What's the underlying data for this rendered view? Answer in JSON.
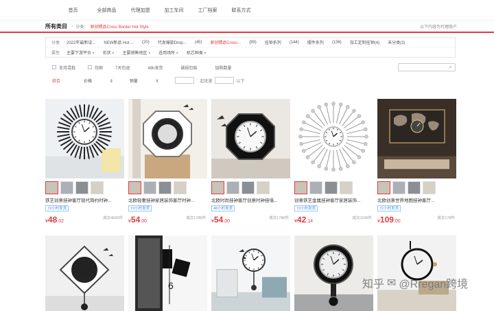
{
  "topnav": [
    "首页",
    "全部商品",
    "代理加盟",
    "加工车间",
    "工厂档案",
    "联系方式"
  ],
  "breadcrumb": {
    "all": "所有类目",
    "items": [
      "分类：",
      "原创精品Cross Border Hot Style"
    ],
    "right": "以下内容为代理商户"
  },
  "filters": [
    {
      "label": "分类",
      "options": [
        "2022年最新设...",
        "NEW新品 Hot ...",
        "(20)",
        "代发爆款Drop...",
        "(45)",
        "原创精品Cross...",
        "(89)",
        "挂钟系列",
        "(144)",
        "摆件系列",
        "(136)",
        "加工定制挂钟(4)",
        "未分类(3)"
      ],
      "active_index": 5
    },
    {
      "label": "属性",
      "options": [
        "主要下游平台",
        "形状",
        "主要销售地区",
        "适用场所",
        "机芯种类"
      ],
      "dropdown": true
    }
  ],
  "options": {
    "checks": [
      "支持混批",
      "包邮"
    ],
    "plain": [
      "7天包退",
      "48h发货",
      "破损包赔",
      "加购数量"
    ],
    "search_icon": "search-icon"
  },
  "sortbar": {
    "items": [
      "综合",
      "价格",
      "销量"
    ],
    "active": "综合",
    "price_mid": "起批量",
    "price_unit": "以下"
  },
  "products": [
    {
      "title": "铁艺创意挂钟客厅现代简约时钟...",
      "badges": [
        "72小时发货"
      ],
      "price_int": "48",
      "price_dec": ".02",
      "sold": "成交4066件",
      "style": "sunburst"
    },
    {
      "title": "北欧轻奢挂钟家居装饰客厅时钟...",
      "badges": [
        "72小时发货"
      ],
      "price_int": "54",
      "price_dec": ".00",
      "sold": "成交1786件",
      "style": "octagon"
    },
    {
      "title": "北欧时尚挂钟客厅创意时钟挂墙...",
      "badges": [
        "48小时发货"
      ],
      "price_int": "54",
      "price_dec": ".00",
      "sold": "成交1786件",
      "style": "octagon2"
    },
    {
      "title": "创意铁艺金属挂钟客厅家居装饰...",
      "badges": [
        "72小时发货"
      ],
      "price_int": "42",
      "price_dec": ".14",
      "sold": "成交1106件",
      "style": "starburst"
    },
    {
      "title": "北欧创意世界地图挂钟客厅...",
      "badges": [
        "72小时发货"
      ],
      "price_int": "109",
      "price_dec": ".00",
      "sold": "成交178件",
      "style": "worldmap"
    },
    {
      "title": "",
      "badges": [],
      "price_int": "",
      "price_dec": "",
      "sold": "",
      "style": "diamond"
    },
    {
      "title": "",
      "badges": [],
      "price_int": "",
      "price_dec": "",
      "sold": "",
      "style": "door"
    },
    {
      "title": "",
      "badges": [],
      "price_int": "",
      "price_dec": "",
      "sold": "",
      "style": "room"
    },
    {
      "title": "",
      "badges": [],
      "price_int": "",
      "price_dec": "",
      "sold": "",
      "style": "pendulum"
    },
    {
      "title": "",
      "badges": [],
      "price_int": "",
      "price_dec": "",
      "sold": "",
      "style": "ring"
    }
  ],
  "watermark": {
    "text1": "知乎",
    "text2": "@Rregan跨境"
  },
  "colors": {
    "accent": "#e4393c",
    "badge_blue": "#3a8ee6"
  }
}
